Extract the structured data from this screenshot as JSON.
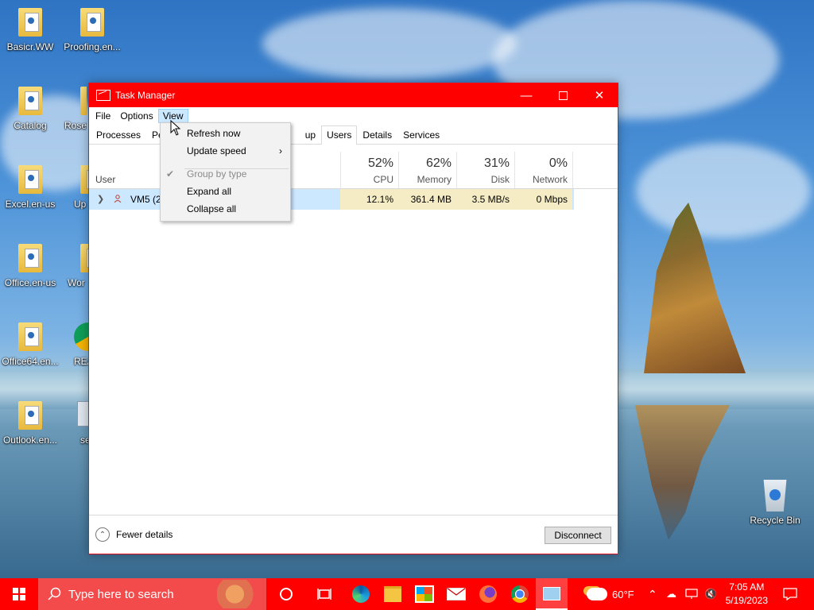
{
  "desktop": {
    "icons": [
      {
        "label": "Basicr.WW"
      },
      {
        "label": "Proofing.en..."
      },
      {
        "label": "Catalog"
      },
      {
        "label": "Rosel"
      },
      {
        "label": "Excel.en-us"
      },
      {
        "label": "Up"
      },
      {
        "label": "Office.en-us"
      },
      {
        "label": "Wor"
      },
      {
        "label": "Office64.en..."
      },
      {
        "label": "REA"
      },
      {
        "label": "Outlook.en..."
      },
      {
        "label": "se"
      },
      {
        "label": "Recycle Bin"
      }
    ]
  },
  "window": {
    "title": "Task Manager",
    "menu": [
      "File",
      "Options",
      "View"
    ],
    "tabs": [
      "Processes",
      "Per",
      "up",
      "Users",
      "Details",
      "Services"
    ],
    "columns": {
      "user_label": "User",
      "cpu": {
        "pct": "52%",
        "label": "CPU"
      },
      "memory": {
        "pct": "62%",
        "label": "Memory"
      },
      "disk": {
        "pct": "31%",
        "label": "Disk"
      },
      "network": {
        "pct": "0%",
        "label": "Network"
      }
    },
    "row": {
      "user": "VM5 (2",
      "cpu": "12.1%",
      "memory": "361.4 MB",
      "disk": "3.5 MB/s",
      "network": "0 Mbps"
    },
    "footer": {
      "fewer_details": "Fewer details",
      "disconnect": "Disconnect"
    }
  },
  "view_menu": {
    "items": [
      {
        "label": "Refresh now"
      },
      {
        "label": "Update speed"
      },
      {
        "label": "Group by type"
      },
      {
        "label": "Expand all"
      },
      {
        "label": "Collapse all"
      }
    ]
  },
  "taskbar": {
    "search_placeholder": "Type here to search",
    "weather": "60°F",
    "time": "7:05 AM",
    "date": "5/19/2023"
  },
  "colors": {
    "accent": "#ff0000",
    "selection": "#cce8ff",
    "heat": "#f5ecc5"
  }
}
